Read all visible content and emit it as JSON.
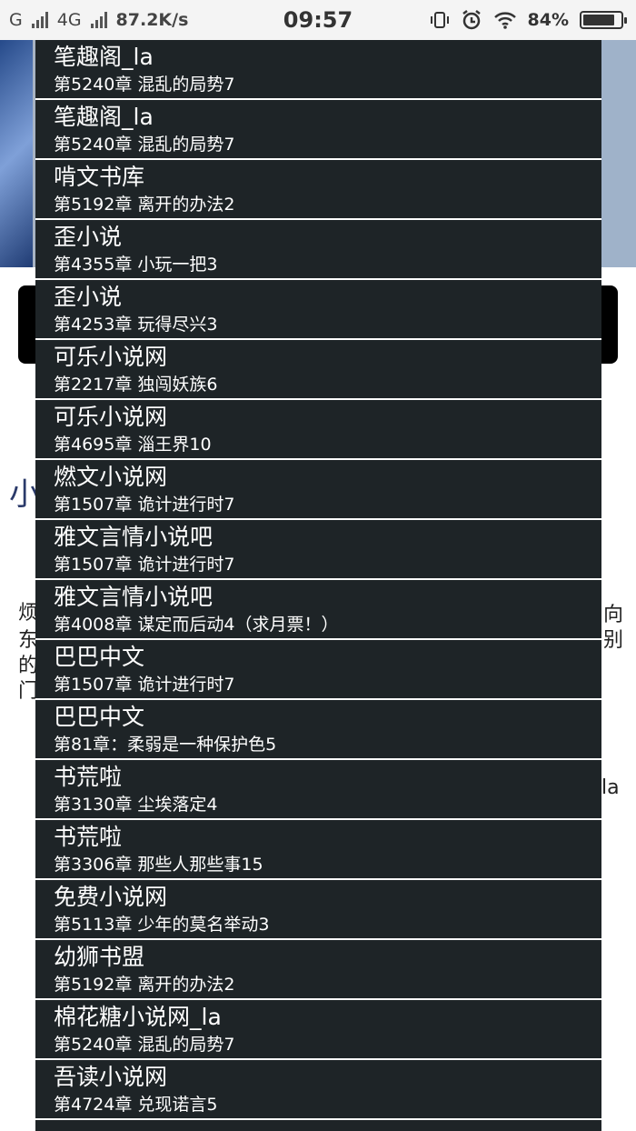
{
  "status_bar": {
    "carrier1": "G",
    "carrier2": "4G",
    "speed": "87.2K/s",
    "time": "09:57",
    "battery": "84%",
    "battery_level": 0.84,
    "icons": [
      "signal-icon",
      "vibrate-icon",
      "alarm-icon",
      "wifi-icon",
      "battery-icon"
    ]
  },
  "background": {
    "frag1": "小",
    "frag2": "烦",
    "frag3": "东",
    "frag4": "的",
    "frag5": "门",
    "frag6": "向",
    "frag7": "别",
    "frag8": "la"
  },
  "source_list": [
    {
      "name": "笔趣阁_la",
      "chapter": "第5240章 混乱的局势7"
    },
    {
      "name": "笔趣阁_la",
      "chapter": "第5240章 混乱的局势7"
    },
    {
      "name": "啃文书库",
      "chapter": "第5192章 离开的办法2"
    },
    {
      "name": "歪小说",
      "chapter": "第4355章 小玩一把3"
    },
    {
      "name": "歪小说",
      "chapter": "第4253章 玩得尽兴3"
    },
    {
      "name": "可乐小说网",
      "chapter": "第2217章 独闯妖族6"
    },
    {
      "name": "可乐小说网",
      "chapter": "第4695章 淄王界10"
    },
    {
      "name": "燃文小说网",
      "chapter": " 第1507章 诡计进行时7"
    },
    {
      "name": "雅文言情小说吧",
      "chapter": "第1507章 诡计进行时7"
    },
    {
      "name": "雅文言情小说吧",
      "chapter": "第4008章 谋定而后动4（求月票！）"
    },
    {
      "name": "巴巴中文",
      "chapter": " 第1507章 诡计进行时7"
    },
    {
      "name": "巴巴中文",
      "chapter": " 第81章：柔弱是一种保护色5"
    },
    {
      "name": "书荒啦",
      "chapter": "第3130章 尘埃落定4"
    },
    {
      "name": "书荒啦",
      "chapter": "第3306章 那些人那些事15"
    },
    {
      "name": "免费小说网",
      "chapter": "第5113章 少年的莫名举动3"
    },
    {
      "name": "幼狮书盟",
      "chapter": "第5192章 离开的办法2"
    },
    {
      "name": "棉花糖小说网_la",
      "chapter": "第5240章 混乱的局势7"
    },
    {
      "name": "吾读小说网",
      "chapter": "第4724章 兑现诺言5"
    },
    {
      "name": "",
      "chapter": ""
    }
  ]
}
